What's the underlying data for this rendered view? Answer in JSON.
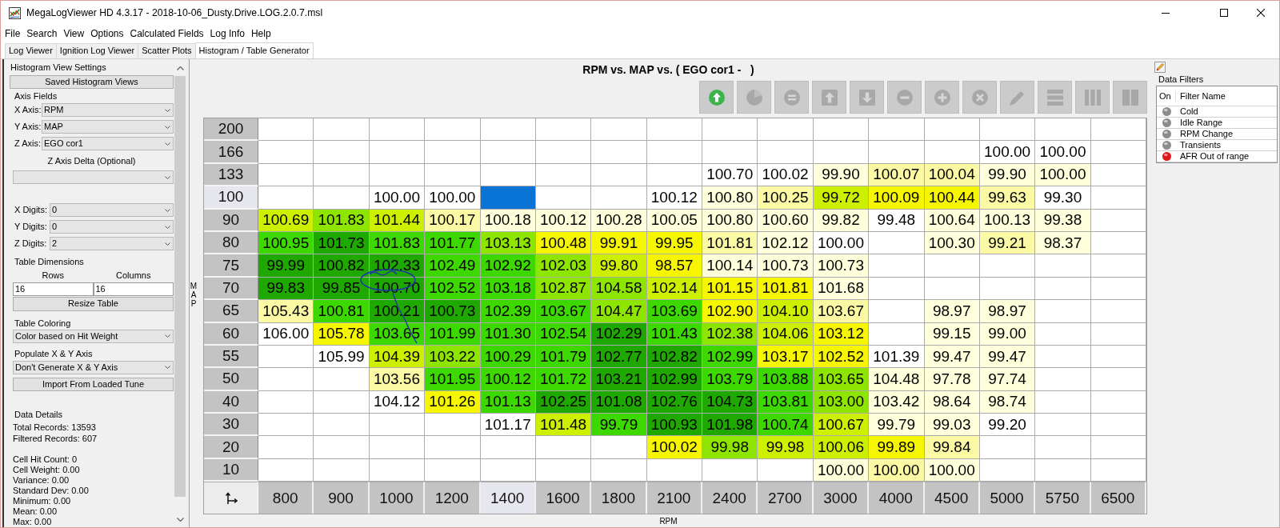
{
  "window": {
    "title": "MegaLogViewer HD 4.3.17 - 2018-10-06_Dusty.Drive.LOG.2.0.7.msl"
  },
  "menu": [
    "File",
    "Search",
    "View",
    "Options",
    "Calculated Fields",
    "Log Info",
    "Help"
  ],
  "tabs": [
    {
      "label": "Log Viewer",
      "selected": false
    },
    {
      "label": "Ignition Log Viewer",
      "selected": false
    },
    {
      "label": "Scatter Plots",
      "selected": false
    },
    {
      "label": "Histogram / Table Generator",
      "selected": true
    }
  ],
  "settings": {
    "title": "Histogram View Settings",
    "saved_views_button": "Saved Histogram Views",
    "axis_fields": {
      "heading": "Axis Fields",
      "fields": [
        {
          "label": "X Axis:",
          "value": "RPM"
        },
        {
          "label": "Y Axis:",
          "value": "MAP"
        },
        {
          "label": "Z Axis:",
          "value": "EGO cor1"
        }
      ],
      "delta_label": "Z Axis Delta (Optional)"
    },
    "digits": [
      {
        "label": "X Digits:",
        "value": "0"
      },
      {
        "label": "Y Digits:",
        "value": "0"
      },
      {
        "label": "Z Digits:",
        "value": "2"
      }
    ],
    "table_dimensions": {
      "heading": "Table Dimensions",
      "rows_label": "Rows",
      "columns_label": "Columns",
      "rows_value": "16",
      "columns_value": "16",
      "button": "Resize Table"
    },
    "table_coloring": {
      "heading": "Table Coloring",
      "value": "Color based on Hit Weight"
    },
    "populate_axis": {
      "heading": "Populate X & Y Axis",
      "value": "Don't Generate X & Y Axis",
      "button": "Import From Loaded Tune"
    },
    "data_details": {
      "heading": "Data Details",
      "records": [
        "Total Records: 13593",
        "Filtered Records: 607"
      ],
      "cell_stats": [
        "Cell Hit Count: 0",
        "Cell Weight: 0.00",
        "Variance: 0.00",
        "Standard Dev: 0.00",
        "Minimum: 0.00",
        "Mean: 0.00",
        "Max: 0.00"
      ]
    }
  },
  "histogram": {
    "title": "RPM vs. MAP vs. ( EGO cor1 -   )",
    "toolbar": [
      {
        "kind": "refresh",
        "disabled": false
      },
      {
        "kind": "pie",
        "disabled": true
      },
      {
        "kind": "equals",
        "disabled": true
      },
      {
        "kind": "move-up",
        "disabled": true
      },
      {
        "kind": "move-down",
        "disabled": true
      },
      {
        "kind": "minus",
        "disabled": true
      },
      {
        "kind": "plus",
        "disabled": true
      },
      {
        "kind": "clear",
        "disabled": true
      },
      {
        "kind": "pencil",
        "disabled": true
      },
      {
        "kind": "rows",
        "disabled": true
      },
      {
        "kind": "columns",
        "disabled": true
      },
      {
        "kind": "split",
        "disabled": true
      }
    ],
    "y_axis_label": "MAP",
    "x_axis_label": "RPM",
    "columns": [
      {
        "label": "800",
        "selected": false
      },
      {
        "label": "900",
        "selected": false
      },
      {
        "label": "1000",
        "selected": false
      },
      {
        "label": "1200",
        "selected": false
      },
      {
        "label": "1400",
        "selected": true
      },
      {
        "label": "1600",
        "selected": false
      },
      {
        "label": "1800",
        "selected": false
      },
      {
        "label": "2100",
        "selected": false
      },
      {
        "label": "2400",
        "selected": false
      },
      {
        "label": "2700",
        "selected": false
      },
      {
        "label": "3000",
        "selected": false
      },
      {
        "label": "4000",
        "selected": false
      },
      {
        "label": "4500",
        "selected": false
      },
      {
        "label": "5000",
        "selected": false
      },
      {
        "label": "5750",
        "selected": false
      },
      {
        "label": "6500",
        "selected": false
      }
    ],
    "rows": [
      {
        "label": "200",
        "selected": false
      },
      {
        "label": "166",
        "selected": false,
        "cells": [
          null,
          null,
          null,
          null,
          null,
          null,
          null,
          null,
          null,
          null,
          null,
          null,
          null,
          {
            "value": "100.00",
            "color": "#ffffff"
          },
          {
            "value": "100.00",
            "color": "#ffffff"
          },
          null
        ]
      },
      {
        "label": "133",
        "selected": false,
        "cells": [
          null,
          null,
          null,
          null,
          null,
          null,
          null,
          null,
          {
            "value": "100.70",
            "color": "#ffffff"
          },
          {
            "value": "100.02",
            "color": "#ffffff"
          },
          {
            "value": "99.90",
            "color": "#ffffdc"
          },
          {
            "value": "100.07",
            "color": "#fbf9a4"
          },
          {
            "value": "100.04",
            "color": "#fbf9a4"
          },
          {
            "value": "99.90",
            "color": "#ffffdc"
          },
          {
            "value": "100.00",
            "color": "#ffffdc"
          },
          null
        ]
      },
      {
        "label": "100",
        "selected": true,
        "cells": [
          null,
          null,
          {
            "value": "100.00",
            "color": "#ffffff"
          },
          {
            "value": "100.00",
            "color": "#ffffff"
          },
          null,
          null,
          null,
          {
            "value": "100.12",
            "color": "#ffffff"
          },
          {
            "value": "100.80",
            "color": "#ffffdc"
          },
          {
            "value": "100.25",
            "color": "#fbf9a4"
          },
          {
            "value": "99.72",
            "color": "#ccf000"
          },
          {
            "value": "100.09",
            "color": "#f6f600"
          },
          {
            "value": "100.44",
            "color": "#f6f600"
          },
          {
            "value": "99.63",
            "color": "#fbf9a4"
          },
          {
            "value": "99.30",
            "color": "#ffffff"
          },
          null
        ]
      },
      {
        "label": "90",
        "selected": false,
        "cells": [
          {
            "value": "100.69",
            "color": "#ccf000"
          },
          {
            "value": "101.83",
            "color": "#8ee600"
          },
          {
            "value": "101.44",
            "color": "#ccf000"
          },
          {
            "value": "100.17",
            "color": "#fbf9a4"
          },
          {
            "value": "100.18",
            "color": "#ffffdc"
          },
          {
            "value": "100.12",
            "color": "#ffffdc"
          },
          {
            "value": "100.28",
            "color": "#ffffdc"
          },
          {
            "value": "100.05",
            "color": "#ffffdc"
          },
          {
            "value": "100.80",
            "color": "#ffffdc"
          },
          {
            "value": "100.60",
            "color": "#ffffdc"
          },
          {
            "value": "99.82",
            "color": "#ffffdc"
          },
          {
            "value": "99.48",
            "color": "#ffffff"
          },
          {
            "value": "100.64",
            "color": "#ffffdc"
          },
          {
            "value": "100.13",
            "color": "#ffffdc"
          },
          {
            "value": "99.38",
            "color": "#ffffdc"
          },
          null
        ]
      },
      {
        "label": "80",
        "selected": false,
        "cells": [
          {
            "value": "100.95",
            "color": "#3cd800"
          },
          {
            "value": "101.73",
            "color": "#1fa800"
          },
          {
            "value": "101.83",
            "color": "#3cd800"
          },
          {
            "value": "101.77",
            "color": "#3cd800"
          },
          {
            "value": "103.13",
            "color": "#8ee600"
          },
          {
            "value": "100.48",
            "color": "#f6f600"
          },
          {
            "value": "99.91",
            "color": "#f6f600"
          },
          {
            "value": "99.95",
            "color": "#f6f600"
          },
          {
            "value": "101.81",
            "color": "#fbf9a4"
          },
          {
            "value": "102.12",
            "color": "#ffffdc"
          },
          {
            "value": "100.00",
            "color": "#ffffff"
          },
          null,
          {
            "value": "100.30",
            "color": "#ffffdc"
          },
          {
            "value": "99.21",
            "color": "#fbf9a4"
          },
          {
            "value": "98.37",
            "color": "#ffffdc"
          },
          null
        ]
      },
      {
        "label": "75",
        "selected": false,
        "cells": [
          {
            "value": "99.99",
            "color": "#1fa800"
          },
          {
            "value": "100.82",
            "color": "#1fa800"
          },
          {
            "value": "102.33",
            "color": "#1fa800"
          },
          {
            "value": "102.49",
            "color": "#3cd800"
          },
          {
            "value": "102.92",
            "color": "#3cd800"
          },
          {
            "value": "102.03",
            "color": "#8ee600"
          },
          {
            "value": "99.80",
            "color": "#ccf000"
          },
          {
            "value": "98.57",
            "color": "#f6f600"
          },
          {
            "value": "100.14",
            "color": "#ffffdc"
          },
          {
            "value": "100.73",
            "color": "#ffffdc"
          },
          {
            "value": "100.73",
            "color": "#ffffdc"
          },
          null,
          null,
          null,
          null,
          null
        ]
      },
      {
        "label": "70",
        "selected": false,
        "cells": [
          {
            "value": "99.83",
            "color": "#1fa800"
          },
          {
            "value": "99.85",
            "color": "#1fa800"
          },
          {
            "value": "100.70",
            "color": "#1fa800"
          },
          {
            "value": "102.52",
            "color": "#3cd800"
          },
          {
            "value": "103.18",
            "color": "#3cd800"
          },
          {
            "value": "102.87",
            "color": "#8ee600"
          },
          {
            "value": "104.58",
            "color": "#8ee600"
          },
          {
            "value": "102.14",
            "color": "#ccf000"
          },
          {
            "value": "101.15",
            "color": "#f6f600"
          },
          {
            "value": "101.81",
            "color": "#f6f600"
          },
          {
            "value": "101.68",
            "color": "#ffffdc"
          },
          null,
          null,
          null,
          null,
          null
        ]
      },
      {
        "label": "65",
        "selected": false,
        "cells": [
          {
            "value": "105.43",
            "color": "#fbf9a4"
          },
          {
            "value": "100.81",
            "color": "#3cd800"
          },
          {
            "value": "100.21",
            "color": "#1fa800"
          },
          {
            "value": "100.73",
            "color": "#1fa800"
          },
          {
            "value": "102.39",
            "color": "#3cd800"
          },
          {
            "value": "103.67",
            "color": "#3cd800"
          },
          {
            "value": "104.47",
            "color": "#8ee600"
          },
          {
            "value": "103.69",
            "color": "#3cd800"
          },
          {
            "value": "102.90",
            "color": "#f6f600"
          },
          {
            "value": "104.10",
            "color": "#ccf000"
          },
          {
            "value": "103.67",
            "color": "#fbf9a4"
          },
          null,
          {
            "value": "98.97",
            "color": "#ffffdc"
          },
          {
            "value": "98.97",
            "color": "#ffffdc"
          },
          null,
          null
        ]
      },
      {
        "label": "60",
        "selected": false,
        "cells": [
          {
            "value": "106.00",
            "color": "#ffffff"
          },
          {
            "value": "105.78",
            "color": "#f6f600"
          },
          {
            "value": "103.65",
            "color": "#3cd800"
          },
          {
            "value": "101.99",
            "color": "#3cd800"
          },
          {
            "value": "101.30",
            "color": "#3cd800"
          },
          {
            "value": "102.54",
            "color": "#3cd800"
          },
          {
            "value": "102.29",
            "color": "#1fa800"
          },
          {
            "value": "101.43",
            "color": "#3cd800"
          },
          {
            "value": "102.38",
            "color": "#8ee600"
          },
          {
            "value": "104.06",
            "color": "#ccf000"
          },
          {
            "value": "103.12",
            "color": "#f6f600"
          },
          null,
          {
            "value": "99.15",
            "color": "#ffffdc"
          },
          {
            "value": "99.00",
            "color": "#ffffdc"
          },
          null,
          null
        ]
      },
      {
        "label": "55",
        "selected": false,
        "cells": [
          null,
          {
            "value": "105.99",
            "color": "#ffffff"
          },
          {
            "value": "104.39",
            "color": "#ccf000"
          },
          {
            "value": "103.22",
            "color": "#8ee600"
          },
          {
            "value": "100.29",
            "color": "#3cd800"
          },
          {
            "value": "101.79",
            "color": "#3cd800"
          },
          {
            "value": "102.77",
            "color": "#1fa800"
          },
          {
            "value": "102.82",
            "color": "#1fa800"
          },
          {
            "value": "102.99",
            "color": "#3cd800"
          },
          {
            "value": "103.17",
            "color": "#f6f600"
          },
          {
            "value": "102.52",
            "color": "#f6f600"
          },
          {
            "value": "101.39",
            "color": "#ffffff"
          },
          {
            "value": "99.47",
            "color": "#ffffdc"
          },
          {
            "value": "99.47",
            "color": "#ffffdc"
          },
          null,
          null
        ]
      },
      {
        "label": "50",
        "selected": false,
        "cells": [
          null,
          null,
          {
            "value": "103.56",
            "color": "#fbf9a4"
          },
          {
            "value": "101.95",
            "color": "#3cd800"
          },
          {
            "value": "100.12",
            "color": "#3cd800"
          },
          {
            "value": "101.72",
            "color": "#3cd800"
          },
          {
            "value": "103.21",
            "color": "#1fa800"
          },
          {
            "value": "102.99",
            "color": "#1fa800"
          },
          {
            "value": "103.79",
            "color": "#3cd800"
          },
          {
            "value": "103.88",
            "color": "#3cd800"
          },
          {
            "value": "103.65",
            "color": "#8ee600"
          },
          {
            "value": "104.48",
            "color": "#ffffdc"
          },
          {
            "value": "97.78",
            "color": "#ffffdc"
          },
          {
            "value": "97.74",
            "color": "#ffffdc"
          },
          null,
          null
        ]
      },
      {
        "label": "40",
        "selected": false,
        "cells": [
          null,
          null,
          {
            "value": "104.12",
            "color": "#ffffff"
          },
          {
            "value": "101.26",
            "color": "#f6f600"
          },
          {
            "value": "101.13",
            "color": "#3cd800"
          },
          {
            "value": "102.25",
            "color": "#1fa800"
          },
          {
            "value": "101.08",
            "color": "#1fa800"
          },
          {
            "value": "102.76",
            "color": "#1fa800"
          },
          {
            "value": "104.73",
            "color": "#1fa800"
          },
          {
            "value": "103.81",
            "color": "#3cd800"
          },
          {
            "value": "103.00",
            "color": "#8ee600"
          },
          {
            "value": "103.42",
            "color": "#ffffdc"
          },
          {
            "value": "98.64",
            "color": "#ffffdc"
          },
          {
            "value": "98.74",
            "color": "#ffffdc"
          },
          null,
          null
        ]
      },
      {
        "label": "30",
        "selected": false,
        "cells": [
          null,
          null,
          null,
          null,
          {
            "value": "101.17",
            "color": "#ffffff"
          },
          {
            "value": "101.48",
            "color": "#ccf000"
          },
          {
            "value": "99.79",
            "color": "#3cd800"
          },
          {
            "value": "100.93",
            "color": "#1fa800"
          },
          {
            "value": "101.98",
            "color": "#1fa800"
          },
          {
            "value": "100.74",
            "color": "#3cd800"
          },
          {
            "value": "100.67",
            "color": "#ccf000"
          },
          {
            "value": "99.79",
            "color": "#ffffdc"
          },
          {
            "value": "99.03",
            "color": "#ffffdc"
          },
          {
            "value": "99.20",
            "color": "#ffffff"
          },
          null,
          null
        ]
      },
      {
        "label": "20",
        "selected": false,
        "cells": [
          null,
          null,
          null,
          null,
          null,
          null,
          null,
          {
            "value": "100.02",
            "color": "#f6f600"
          },
          {
            "value": "99.98",
            "color": "#8ee600"
          },
          {
            "value": "99.98",
            "color": "#ccf000"
          },
          {
            "value": "100.06",
            "color": "#ccf000"
          },
          {
            "value": "99.89",
            "color": "#f6f600"
          },
          {
            "value": "99.84",
            "color": "#fbf9a4"
          },
          null,
          null,
          null
        ]
      },
      {
        "label": "10",
        "selected": false,
        "cells": [
          null,
          null,
          null,
          null,
          null,
          null,
          null,
          null,
          null,
          null,
          {
            "value": "100.00",
            "color": "#ffffdc"
          },
          {
            "value": "100.00",
            "color": "#fbf9a4"
          },
          {
            "value": "100.00",
            "color": "#ffffdc"
          },
          null,
          null,
          null
        ]
      }
    ]
  },
  "data_filters": {
    "title": "Data Filters",
    "headers": [
      "On",
      "Filter Name"
    ],
    "filters": [
      {
        "name": "Cold",
        "on": false
      },
      {
        "name": "Idle Range",
        "on": false
      },
      {
        "name": "RPM Change",
        "on": false
      },
      {
        "name": "Transients",
        "on": false
      },
      {
        "name": "AFR Out of range",
        "on": true
      }
    ]
  }
}
